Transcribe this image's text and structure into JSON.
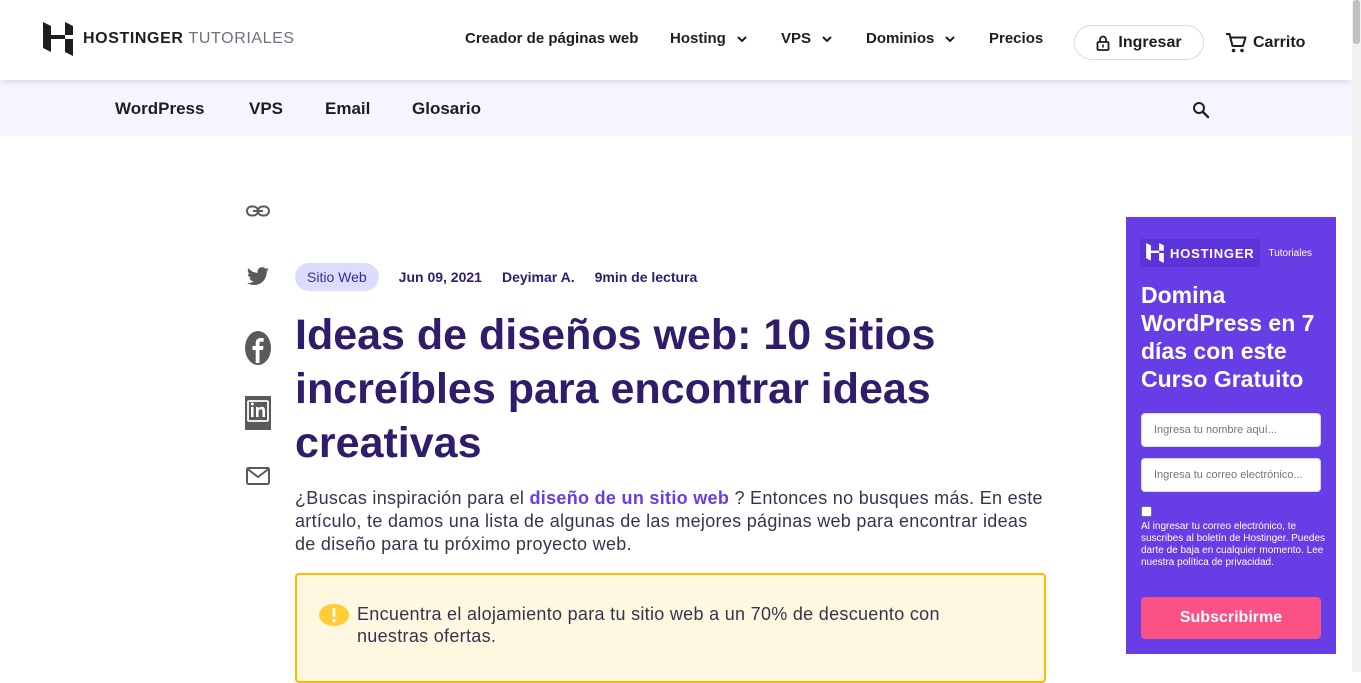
{
  "header": {
    "logo_brand": "HOSTINGER",
    "logo_section": "TUTORIALES",
    "nav": [
      {
        "label": "Creador de páginas web",
        "has_dropdown": false
      },
      {
        "label": "Hosting",
        "has_dropdown": true
      },
      {
        "label": "VPS",
        "has_dropdown": true
      },
      {
        "label": "Dominios",
        "has_dropdown": true
      },
      {
        "label": "Precios",
        "has_dropdown": false
      }
    ],
    "login_label": "Ingresar",
    "cart_label": "Carrito"
  },
  "subnav": {
    "items": [
      "WordPress",
      "VPS",
      "Email",
      "Glosario"
    ],
    "search_icon": "search-icon"
  },
  "share": {
    "icons": [
      "link-icon",
      "twitter-icon",
      "facebook-icon",
      "linkedin-icon",
      "email-icon"
    ]
  },
  "article": {
    "category": "Sitio Web",
    "date": "Jun 09, 2021",
    "author": "Deyimar A.",
    "read_time": "9min de lectura",
    "title": "Ideas de diseños web: 10 sitios increíbles para encontrar ideas creativas",
    "intro_before": "¿Buscas inspiración para el ",
    "intro_link": "diseño de un sitio web",
    "intro_after": " ? Entonces no busques más. En este artículo, te damos una lista de algunas de las mejores páginas web para encontrar ideas de diseño para tu próximo proyecto web.",
    "promo_text": "Encuentra el alojamiento para tu sitio web a un 70% de descuento con nuestras ofertas."
  },
  "sidebar": {
    "brand": "HOSTINGER",
    "brand_sub": "Tutoriales",
    "title": "Domina WordPress en 7 días con este Curso Gratuito",
    "name_placeholder": "Ingresa tu nombre aquí...",
    "email_placeholder": "Ingresa tu correo electrónico...",
    "legal": "Al ingresar tu correo electrónico, te suscribes al boletín de Hostinger. Puedes darte de baja en cualquier momento. Lee nuestra política de privacidad.",
    "subscribe_label": "Subscribirme"
  },
  "colors": {
    "brand_purple": "#673de6",
    "title_purple": "#2f1c6a",
    "subscribe_pink": "#fc5185",
    "promo_border": "#ffb900",
    "promo_bg": "#fff8e1",
    "subnav_bg": "#f4f5ff"
  }
}
